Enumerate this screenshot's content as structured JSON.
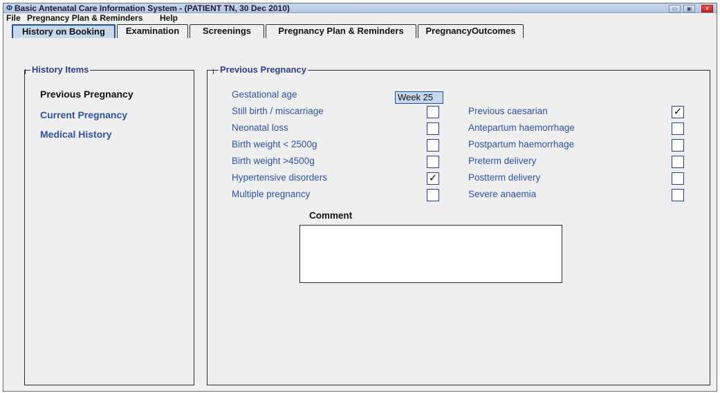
{
  "window": {
    "icon": "app-icon",
    "title": "Basic Antenatal Care Information System - (PATIENT TN, 30 Dec 2010)",
    "controls": {
      "minimize": "▭",
      "maximize": "▣",
      "close": "×"
    }
  },
  "menu": [
    "File",
    "Pregnancy Plan & Reminders",
    "Help"
  ],
  "tabs": [
    "History on Booking",
    "Examination",
    "Screenings",
    "Pregnancy Plan & Reminders",
    "PregnancyOutcomes"
  ],
  "active_tab": "History on Booking",
  "history_items": {
    "title": "History Items",
    "items": [
      "Previous Pregnancy",
      "Current Pregnancy",
      "Medical History"
    ],
    "selected": "Previous Pregnancy"
  },
  "previous_pregnancy": {
    "title": "Previous Pregnancy",
    "gestational_age": {
      "label": "Gestational age",
      "value": "Week 25"
    },
    "left_checks": [
      {
        "label": "Still birth / miscarriage",
        "checked": false
      },
      {
        "label": "Neonatal loss",
        "checked": false
      },
      {
        "label": "Birth weight < 2500g",
        "checked": false
      },
      {
        "label": "Birth weight >4500g",
        "checked": false
      },
      {
        "label": "Hypertensive disorders",
        "checked": true
      },
      {
        "label": "Multiple pregnancy",
        "checked": false
      }
    ],
    "right_checks": [
      {
        "label": "Previous caesarian",
        "checked": true
      },
      {
        "label": "Antepartum haemorrhage",
        "checked": false
      },
      {
        "label": "Postpartum haemorrhage",
        "checked": false
      },
      {
        "label": "Preterm delivery",
        "checked": false
      },
      {
        "label": "Postterm delivery",
        "checked": false
      },
      {
        "label": "Severe anaemia",
        "checked": false
      }
    ],
    "comment_label": "Comment",
    "comment_value": ""
  },
  "check_mark": "✓",
  "colors": {
    "accent": "#1f4f97",
    "label_blue": "#2b52a8",
    "group_title": "#2e3f8f",
    "active_tab_bg": "#c6d8ee"
  }
}
